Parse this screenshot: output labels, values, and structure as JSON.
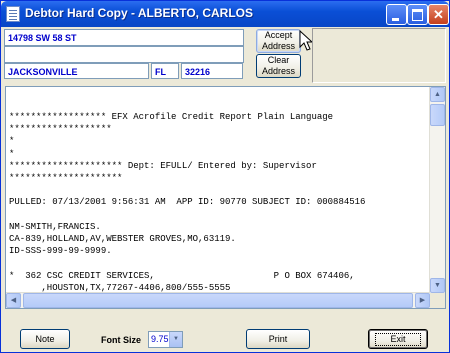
{
  "window": {
    "title": "Debtor Hard Copy - ALBERTO, CARLOS"
  },
  "address": {
    "street": "14798 SW 58 ST",
    "line2": "",
    "city": "JACKSONVILLE",
    "state": "FL",
    "zip": "32216"
  },
  "buttons": {
    "accept_label": "Accept Address",
    "clear_label": "Clear Address",
    "note_label": "Note",
    "print_label": "Print",
    "exit_label": "Exit"
  },
  "font_size": {
    "label": "Font Size",
    "selected": "9.75"
  },
  "report": {
    "lines": [
      "****************** EFX Acrofile Credit Report Plain Language",
      "*******************",
      "*",
      "*",
      "********************* Dept: EFULL/ Entered by: Supervisor",
      "*********************",
      "",
      "PULLED: 07/13/2001 9:56:31 AM  APP ID: 90770 SUBJECT ID: 000884516",
      "",
      "NM-SMITH,FRANCIS.",
      "CA-839,HOLLAND,AV,WEBSTER GROVES,MO,63119.",
      "ID-SSS-999-99-9999.",
      "",
      "*  362 CSC CREDIT SERVICES,                      P O BOX 674406,",
      "      ,HOUSTON,TX,77267-4406,800/555-5555"
    ]
  },
  "colors": {
    "title_bar": "#0a4fd6",
    "field_text": "#0000cc",
    "window_bg": "#ece9d8"
  },
  "icons": [
    "app-document-icon",
    "minimize-icon",
    "maximize-icon",
    "close-icon",
    "mouse-pointer-icon"
  ]
}
